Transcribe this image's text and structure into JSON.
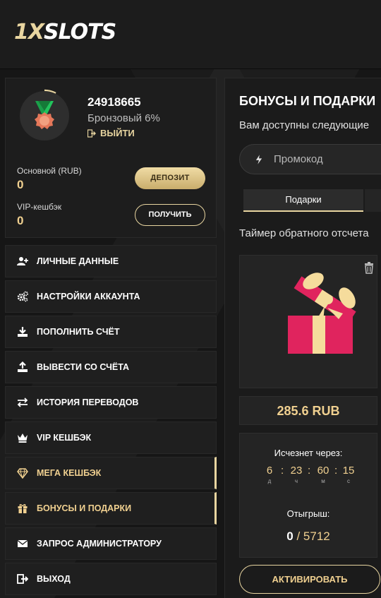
{
  "header": {
    "logo_prefix": "1X",
    "logo_suffix": "SLOTS"
  },
  "profile": {
    "user_id": "24918665",
    "level": "Бронзовый 6%",
    "logout_label": "ВЫЙТИ",
    "main_balance_label": "Основной (RUB)",
    "main_balance_value": "0",
    "vip_cashback_label": "VIP-кешбэк",
    "vip_cashback_value": "0",
    "deposit_button": "ДЕПОЗИТ",
    "receive_button": "ПОЛУЧИТЬ"
  },
  "sidebar": {
    "items": [
      {
        "label": "ЛИЧНЫЕ ДАННЫЕ",
        "icon": "user-plus-icon",
        "active": false
      },
      {
        "label": "НАСТРОЙКИ АККАУНТА",
        "icon": "gears-icon",
        "active": false
      },
      {
        "label": "ПОПОЛНИТЬ СЧЁТ",
        "icon": "download-icon",
        "active": false
      },
      {
        "label": "ВЫВЕСТИ СО СЧЁТА",
        "icon": "upload-icon",
        "active": false
      },
      {
        "label": "ИСТОРИЯ ПЕРЕВОДОВ",
        "icon": "transfer-arrows-icon",
        "active": false
      },
      {
        "label": "VIP КЕШБЭК",
        "icon": "crown-icon",
        "active": false
      },
      {
        "label": "МЕГА КЕШБЭК",
        "icon": "diamond-icon",
        "active": true
      },
      {
        "label": "БОНУСЫ И ПОДАРКИ",
        "icon": "gift-icon",
        "active": true
      },
      {
        "label": "ЗАПРОС АДМИНИСТРАТОРУ",
        "icon": "envelope-icon",
        "active": false
      },
      {
        "label": "ВЫХОД",
        "icon": "exit-icon",
        "active": false
      }
    ]
  },
  "main": {
    "title": "БОНУСЫ И ПОДАРКИ",
    "subtitle": "Вам доступны следующие",
    "promo_placeholder": "Промокод",
    "tabs": [
      {
        "label": "Подарки"
      }
    ],
    "timer_text": "Таймер обратного отсчета",
    "gift_amount": "285.6 RUB",
    "vanish_label": "Исчезнет через:",
    "countdown": [
      {
        "value": "6",
        "unit": "д"
      },
      {
        "value": "23",
        "unit": "ч"
      },
      {
        "value": "60",
        "unit": "м"
      },
      {
        "value": "15",
        "unit": "с"
      }
    ],
    "wager_label": "Отыгрыш:",
    "wager_current": "0",
    "wager_separator": "/",
    "wager_total": "5712",
    "activate_button": "АКТИВИРОВАТЬ"
  },
  "colors": {
    "accent": "#e8d5a0",
    "gold_text": "#f0d090",
    "gift_box": "#e0245e",
    "gift_ribbon": "#f5dc9c"
  }
}
